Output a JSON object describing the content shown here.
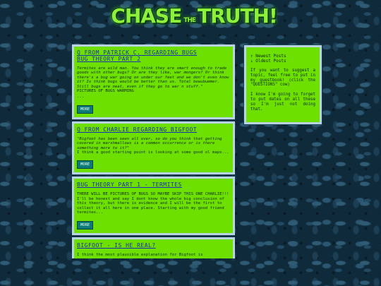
{
  "logo": {
    "left": "CHASE",
    "middle": "THE",
    "right": "TRUTH!"
  },
  "posts": [
    {
      "title_line1": "Q FROM PATRICK C. REGARDING BUGS",
      "title_line2": "BUG THEORY PART 2",
      "question": "Termites are wild man. You think they are smart enough to trade goods with other bugs? Or are they like, war mongers? Or think there's a bug war going on under our feet and we don't even know it? Is think bugs would be better than us. Total bewubummer. Still bugs are neat, even if they go to war n stuff.\"",
      "answer": "PICTURES OF BUGS WARMING",
      "ellipsis": "...",
      "more_label": "MORE"
    },
    {
      "title_line1": "Q FROM CHARLIE REGARDING BIGFOOT",
      "question": "\"Bigfoot has been seen all over, so do you think that getting covered in marshmallows is a common occurrence or is there something more to it?\"",
      "answer": "I think a good starting point is looking at some good ol maps...",
      "more_label": "MORE"
    },
    {
      "title_line1": "BUG THEORY PART 1 - TERMITES",
      "answer": "THERE WILL BE PICTURES OF BUGS SO MAYBE SKIP THIS ONE CHARLIE!!! I'll be honest and say I dont know the whole big conclusion of this theory, but there is evidence and I will be the first to collect it all here in one place. Starting with my good friend termites...",
      "more_label": "MORE"
    },
    {
      "title_line1": "BIGFOOT - IS HE REAL?",
      "answer": "I think the most plausible explanation for Bigfoot is"
    }
  ],
  "sidebar": {
    "newest": "↑ Newest Posts",
    "oldest": "↓ Oldest Posts",
    "para1": "If you want to suggest a topic, feel free to put in my guestbook! (click the \"QUESTIONS\" cow)",
    "para2": "I know I'm going to forget to put dates on all these so I'm just not doing that."
  }
}
